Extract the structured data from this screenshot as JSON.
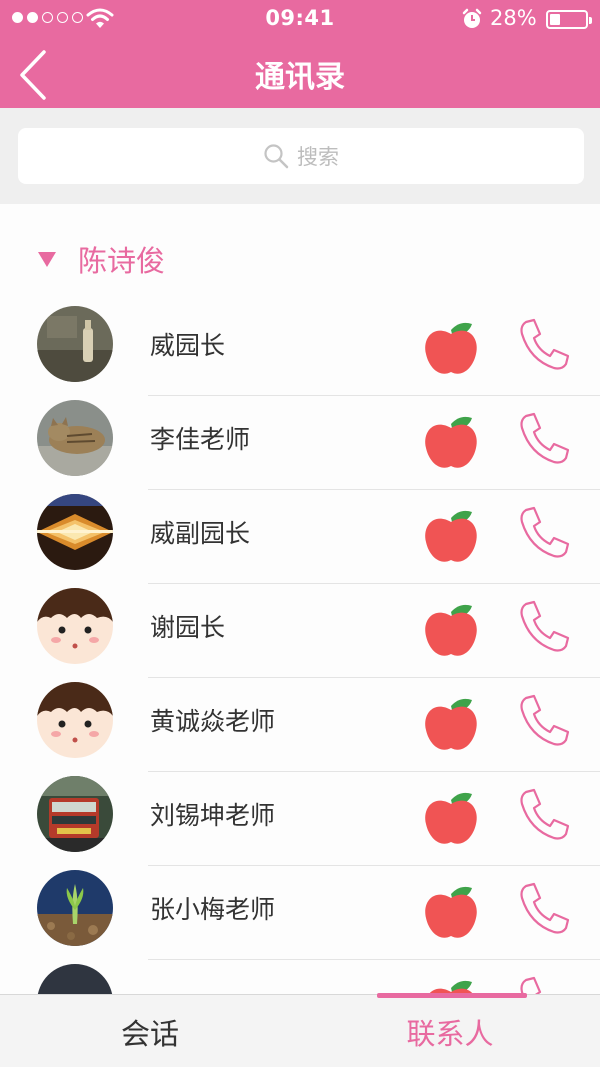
{
  "status_bar": {
    "time": "09:41",
    "battery": "28%"
  },
  "nav": {
    "title": "通讯录"
  },
  "search": {
    "placeholder": "搜索"
  },
  "group": {
    "name": "陈诗俊"
  },
  "contacts": [
    {
      "name": "威园长",
      "avatar": "photo-bottle"
    },
    {
      "name": "李佳老师",
      "avatar": "photo-cat"
    },
    {
      "name": "威副园长",
      "avatar": "photo-abstract"
    },
    {
      "name": "谢园长",
      "avatar": "cartoon-face"
    },
    {
      "name": "黄诚焱老师",
      "avatar": "cartoon-face"
    },
    {
      "name": "刘锡坤老师",
      "avatar": "photo-bus"
    },
    {
      "name": "张小梅老师",
      "avatar": "photo-plant"
    },
    {
      "name": "",
      "avatar": "photo-dark"
    }
  ],
  "icons": {
    "apple": "apple-icon",
    "phone": "phone-icon",
    "back": "chevron-left-icon",
    "search": "search-icon"
  },
  "tabs": [
    {
      "label": "会话",
      "active": false
    },
    {
      "label": "联系人",
      "active": true
    }
  ],
  "colors": {
    "accent": "#e86aa0",
    "apple_red": "#f05454",
    "leaf_green": "#3fa34a"
  }
}
